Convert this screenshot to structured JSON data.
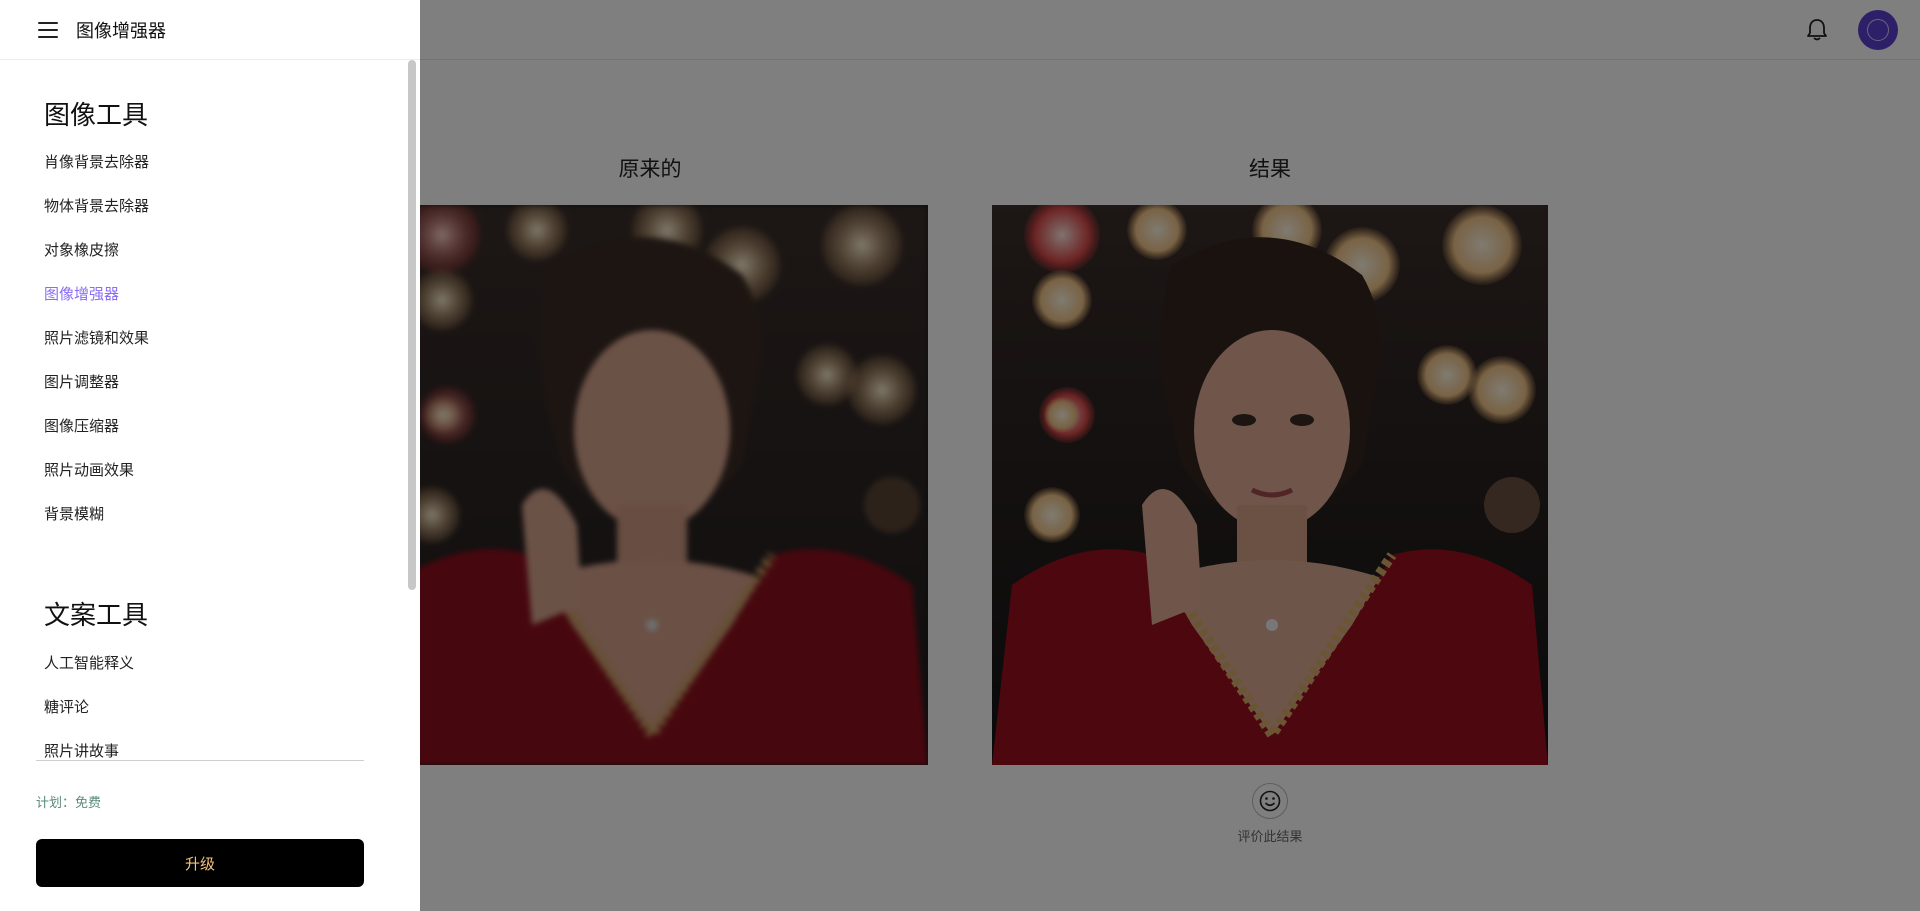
{
  "app": {
    "title": "图像增强器"
  },
  "header": {
    "bell_icon": "bell-icon",
    "avatar_icon": "avatar"
  },
  "compare": {
    "original_label": "原来的",
    "result_label": "结果",
    "rate_label": "评价此结果",
    "rate_icon": "smiley-icon"
  },
  "sidebar": {
    "groups": [
      {
        "title": "图像工具",
        "items": [
          {
            "label": "肖像背景去除器"
          },
          {
            "label": "物体背景去除器"
          },
          {
            "label": "对象橡皮擦"
          },
          {
            "label": "图像增强器",
            "active": true
          },
          {
            "label": "照片滤镜和效果"
          },
          {
            "label": "图片调整器"
          },
          {
            "label": "图像压缩器"
          },
          {
            "label": "照片动画效果"
          },
          {
            "label": "背景模糊"
          }
        ]
      },
      {
        "title": "文案工具",
        "items": [
          {
            "label": "人工智能释义"
          },
          {
            "label": "糖评论"
          },
          {
            "label": "照片讲故事"
          }
        ]
      }
    ],
    "plan_text": "计划：免费",
    "upgrade_label": "升级"
  },
  "colors": {
    "accent": "#8a6cf5",
    "avatar": "#5b3fd1",
    "upgrade_bg": "#000000",
    "upgrade_text": "#f5c27a"
  }
}
